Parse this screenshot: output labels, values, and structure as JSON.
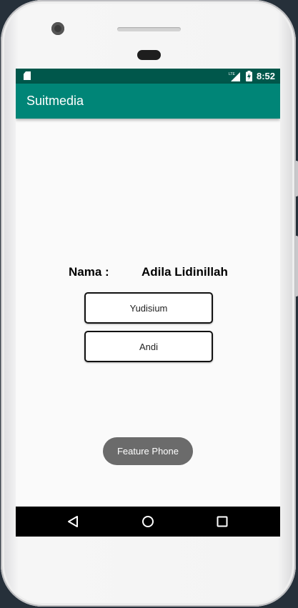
{
  "status_bar": {
    "time": "8:52",
    "network_label": "LTE",
    "icons": [
      "sd-card-icon",
      "lte-signal-icon",
      "battery-charging-icon"
    ]
  },
  "app_bar": {
    "title": "Suitmedia",
    "color": "#008577",
    "status_color": "#00574b"
  },
  "main": {
    "name_label": "Nama :",
    "name_value": "Adila Lidinillah",
    "buttons": [
      {
        "label": "Yudisium"
      },
      {
        "label": "Andi"
      }
    ]
  },
  "toast": {
    "text": "Feature Phone"
  },
  "nav_bar": {
    "icons": [
      "back-icon",
      "home-icon",
      "recents-icon"
    ]
  }
}
